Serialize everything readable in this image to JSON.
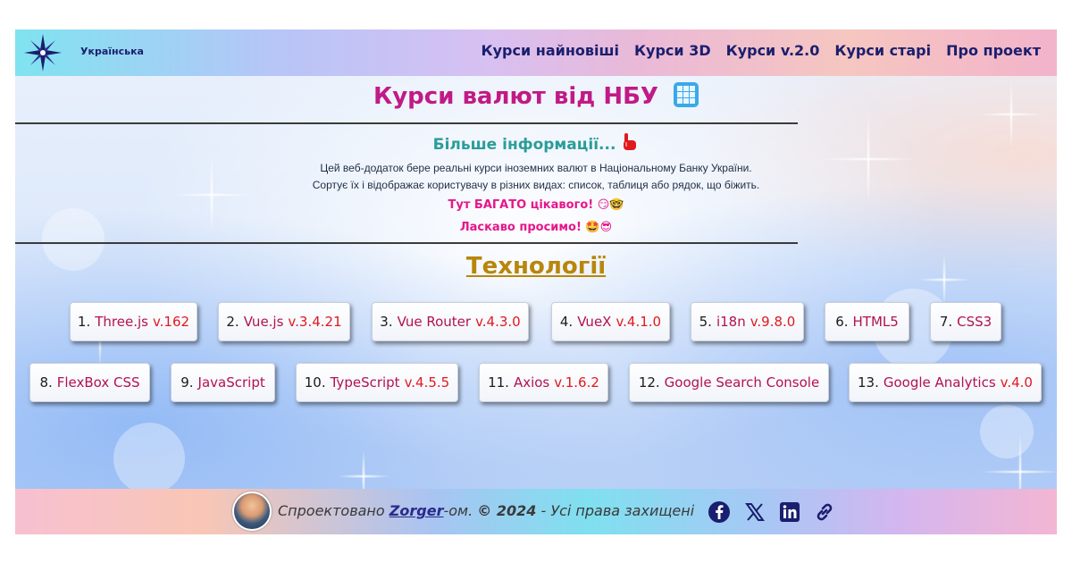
{
  "header": {
    "language": "Українська",
    "nav": [
      {
        "label": "Курси найновіші",
        "name": "nav-latest-rates"
      },
      {
        "label": "Курси 3D",
        "name": "nav-rates-3d"
      },
      {
        "label": "Курси v.2.0",
        "name": "nav-rates-v2"
      },
      {
        "label": "Курси старі",
        "name": "nav-old-rates"
      },
      {
        "label": "Про проект",
        "name": "nav-about"
      }
    ],
    "logo_icon": "compass-star-icon"
  },
  "main": {
    "title": "Курси валют від НБУ",
    "title_icon": "grid-table-icon",
    "more_info": "Більше інформації...",
    "more_icon": "pointing-hand-icon",
    "description_line1": "Цей веб-додаток бере реальні курси іноземних валют в Національному Банку України.",
    "description_line2": "Сортує їх і відображає користувачу в різних видах: список, таблиця або рядок, що біжить.",
    "highlight1": "Тут БАГАТО цікавого! 😏🤓",
    "highlight2": "Ласкаво просимо! 🤩😎",
    "tech_title": "Технології",
    "technologies": [
      {
        "num": "1.",
        "name": "Three.js",
        "version": "v.162"
      },
      {
        "num": "2.",
        "name": "Vue.js",
        "version": "v.3.4.21"
      },
      {
        "num": "3.",
        "name": "Vue Router",
        "version": "v.4.3.0"
      },
      {
        "num": "4.",
        "name": "VueX",
        "version": "v.4.1.0"
      },
      {
        "num": "5.",
        "name": "i18n",
        "version": "v.9.8.0"
      },
      {
        "num": "6.",
        "name": "HTML5",
        "version": ""
      },
      {
        "num": "7.",
        "name": "CSS3",
        "version": ""
      },
      {
        "num": "8.",
        "name": "FlexBox CSS",
        "version": ""
      },
      {
        "num": "9.",
        "name": "JavaScript",
        "version": ""
      },
      {
        "num": "10.",
        "name": "TypeScript",
        "version": "v.4.5.5"
      },
      {
        "num": "11.",
        "name": "Axios",
        "version": "v.1.6.2"
      },
      {
        "num": "12.",
        "name": "Google Search Console",
        "version": ""
      },
      {
        "num": "13.",
        "name": "Google Analytics",
        "version": "v.4.0"
      }
    ]
  },
  "footer": {
    "designed_by": "Спроектовано",
    "author": "Zorger",
    "author_suffix": "-ом.",
    "copyright": "© 2024",
    "rights": "- Усі права захищені",
    "social": [
      "facebook-icon",
      "x-twitter-icon",
      "linkedin-icon",
      "link-icon"
    ]
  },
  "colors": {
    "title": "#c11a86",
    "more_info": "#2a9d9a",
    "highlight": "#e7168b",
    "tech_title": "#b8860b",
    "tech_name": "#b3124f",
    "tech_version": "#e0191f",
    "nav_text": "#1a1e6e"
  }
}
